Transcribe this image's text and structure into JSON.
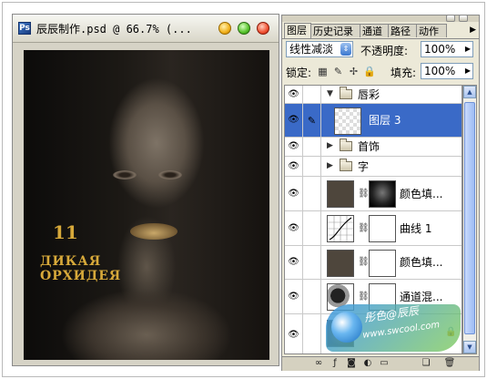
{
  "document": {
    "title": "辰辰制作.psd @ 66.7% (...",
    "logo": {
      "number": "11",
      "line1": "ДИКАЯ",
      "line2": "ОРХИДЕЯ"
    }
  },
  "panel": {
    "tabs": [
      "图层",
      "历史记录",
      "通道",
      "路径",
      "动作"
    ],
    "blend_mode": "线性减淡",
    "opacity_label": "不透明度:",
    "opacity_value": "100%",
    "lock_label": "锁定:",
    "fill_label": "填充:",
    "fill_value": "100%",
    "layers": [
      {
        "name": "唇彩",
        "kind": "group",
        "expanded": true
      },
      {
        "name": "图层 3",
        "kind": "layer",
        "selected": true
      },
      {
        "name": "首饰",
        "kind": "group",
        "expanded": false
      },
      {
        "name": "字",
        "kind": "group",
        "expanded": false
      },
      {
        "name": "颜色填...",
        "kind": "adjustment"
      },
      {
        "name": "曲线 1",
        "kind": "adjustment"
      },
      {
        "name": "颜色填...",
        "kind": "adjustment"
      },
      {
        "name": "通道混...",
        "kind": "adjustment"
      },
      {
        "name": "",
        "kind": "background"
      }
    ]
  },
  "watermark": {
    "line1": "彤色@辰辰",
    "line2": "www.swcool.com"
  },
  "icons": {
    "visibility": "eye-icon",
    "brush": "brush-icon",
    "lock": "lock-icon",
    "link": "chain-icon"
  }
}
